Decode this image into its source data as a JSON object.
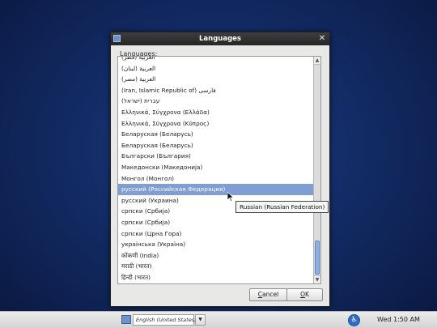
{
  "dialog": {
    "title": "Languages",
    "caption": "Languages:",
    "items": [
      "(العربية (قطر",
      "العربية (لبنان)",
      "العربية (مصر)",
      "(Iran, Islamic Republic of) فارسی",
      "(עברית (ישראל",
      "Ελληνικά, Σύγχρονα (Ελλάδα)",
      "Ελληνικά, Σύγχρονα (Κύπρος)",
      "Беларуская (Беларусь)",
      "Беларуская (Беларусь)",
      "Български (България)",
      "Македонски (Македонија)",
      "Монгол (Монгол)",
      "русский (Российская Федерация)",
      "русский (Украина)",
      "српски (Србија)",
      "српски (Србија)",
      "српски (Црна Гора)",
      "українська (Україна)",
      "कोंकणी (India)",
      "मराठी (भारत)",
      "हिन्दी (भारत)"
    ],
    "selected_index": 12,
    "tooltip": "Russian (Russian Federation)",
    "cancel_label": "Cancel",
    "ok_label": "OK"
  },
  "taskbar": {
    "keyboard_layout": "English (United States)",
    "clock": "Wed  1:50 AM"
  },
  "icons": {
    "close": "close-icon",
    "accessibility": "accessibility-icon",
    "flag": "flag-icon"
  },
  "colors": {
    "selection": "#7f9fd4",
    "desktop": "#132c66"
  }
}
